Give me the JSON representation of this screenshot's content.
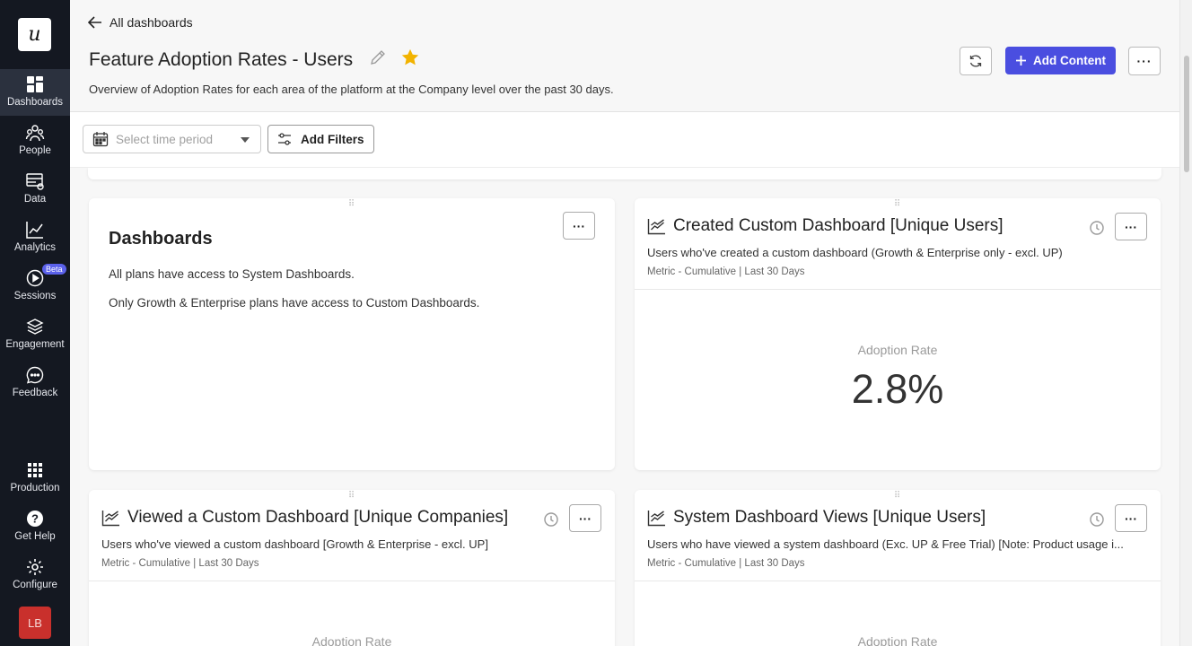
{
  "sidebar": {
    "logo": "u",
    "items": [
      {
        "label": "Dashboards",
        "icon": "dashboards-icon",
        "active": true
      },
      {
        "label": "People",
        "icon": "people-icon"
      },
      {
        "label": "Data",
        "icon": "data-icon"
      },
      {
        "label": "Analytics",
        "icon": "analytics-icon"
      },
      {
        "label": "Sessions",
        "icon": "sessions-icon",
        "badge": "Beta"
      },
      {
        "label": "Engagement",
        "icon": "engagement-icon"
      },
      {
        "label": "Feedback",
        "icon": "feedback-icon"
      }
    ],
    "bottom": [
      {
        "label": "Production",
        "icon": "grid-icon"
      },
      {
        "label": "Get Help",
        "icon": "help-icon"
      },
      {
        "label": "Configure",
        "icon": "gear-icon"
      }
    ],
    "avatar": "LB"
  },
  "header": {
    "back_label": "All dashboards",
    "title": "Feature Adoption Rates - Users",
    "description": "Overview of Adoption Rates for each area of the platform at the Company level over the past 30 days.",
    "add_content_label": "Add Content",
    "accent_color": "#4a4ee0",
    "star_color": "#f2b300"
  },
  "filters": {
    "time_placeholder": "Select time period",
    "add_filters_label": "Add Filters"
  },
  "cards": {
    "text_card": {
      "title": "Dashboards",
      "para1": "All plans have access to System Dashboards.",
      "para2": "Only Growth & Enterprise plans have access to Custom Dashboards."
    },
    "card1": {
      "title": "Created Custom Dashboard [Unique Users]",
      "subtitle": "Users who've created a custom dashboard (Growth & Enterprise only - excl. UP)",
      "meta": "Metric - Cumulative | Last 30 Days",
      "metric_label": "Adoption Rate",
      "metric_value": "2.8%"
    },
    "card2": {
      "title": "Viewed a Custom Dashboard [Unique Companies]",
      "subtitle": "Users who've viewed a custom dashboard [Growth & Enterprise - excl. UP]",
      "meta": "Metric - Cumulative | Last 30 Days",
      "metric_label": "Adoption Rate"
    },
    "card3": {
      "title": "System Dashboard Views [Unique Users]",
      "subtitle": "Users who have viewed a system dashboard (Exc. UP & Free Trial) [Note: Product usage i...",
      "meta": "Metric - Cumulative | Last 30 Days",
      "metric_label": "Adoption Rate"
    }
  }
}
